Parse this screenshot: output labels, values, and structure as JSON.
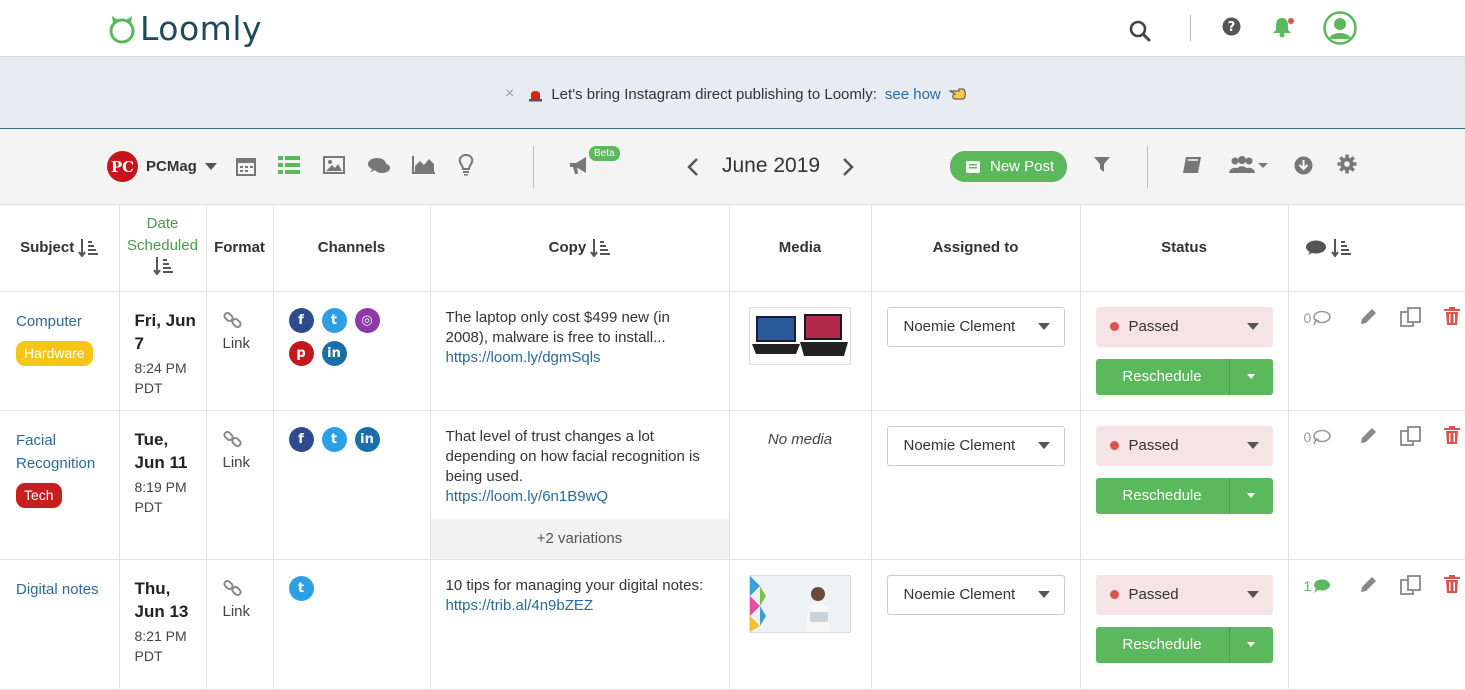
{
  "app": {
    "name": "Loomly",
    "brand_color": "#5cb85c"
  },
  "header": {
    "icons": [
      "search-icon",
      "help-icon",
      "bell-icon",
      "user-avatar-icon"
    ]
  },
  "banner": {
    "text": "Let's bring Instagram direct publishing to Loomly:",
    "link": "see how",
    "close": "×"
  },
  "toolbar": {
    "brand": "PCMag",
    "brand_logo": "PC",
    "beta": "Beta",
    "month": "June 2019",
    "new_post": "New Post"
  },
  "table": {
    "headers": {
      "subject": "Subject",
      "date_scheduled_1": "Date",
      "date_scheduled_2": "Scheduled",
      "format": "Format",
      "channels": "Channels",
      "copy": "Copy",
      "media": "Media",
      "assigned": "Assigned to",
      "status": "Status"
    },
    "rows": [
      {
        "subject": "Computer",
        "tag": "Hardware",
        "day": "Fri, Jun",
        "day2": "7",
        "time": "8:24 PM",
        "tz": "PDT",
        "format": "Link",
        "channels": [
          "facebook",
          "twitter",
          "instagram",
          "pinterest",
          "linkedin"
        ],
        "copy": "The laptop only cost $499 new (in 2008), malware is free to install...",
        "link": "https://loom.ly/dgmSqls",
        "media": "laptops",
        "assigned": "Noemie Clement",
        "status": "Passed",
        "action": "Reschedule",
        "comments": "0"
      },
      {
        "subject": "Facial Recognition",
        "tag": "Tech",
        "day": "Tue,",
        "day2": "Jun 11",
        "time": "8:19 PM",
        "tz": "PDT",
        "format": "Link",
        "channels": [
          "facebook",
          "twitter",
          "linkedin"
        ],
        "copy": "That level of trust changes a lot depending on how facial recognition is being used.",
        "link": "https://loom.ly/6n1B9wQ",
        "variations": "+2 variations",
        "media_text": "No media",
        "assigned": "Noemie Clement",
        "status": "Passed",
        "action": "Reschedule",
        "comments": "0"
      },
      {
        "subject": "Digital notes",
        "day": "Thu,",
        "day2": "Jun 13",
        "time": "8:21 PM",
        "tz": "PDT",
        "format": "Link",
        "channels": [
          "twitter"
        ],
        "copy": "10 tips for managing your digital notes:",
        "link": "https://trib.al/4n9bZEZ",
        "media": "woman-reading",
        "assigned": "Noemie Clement",
        "status": "Passed",
        "action": "Reschedule",
        "comments": "1"
      }
    ]
  }
}
